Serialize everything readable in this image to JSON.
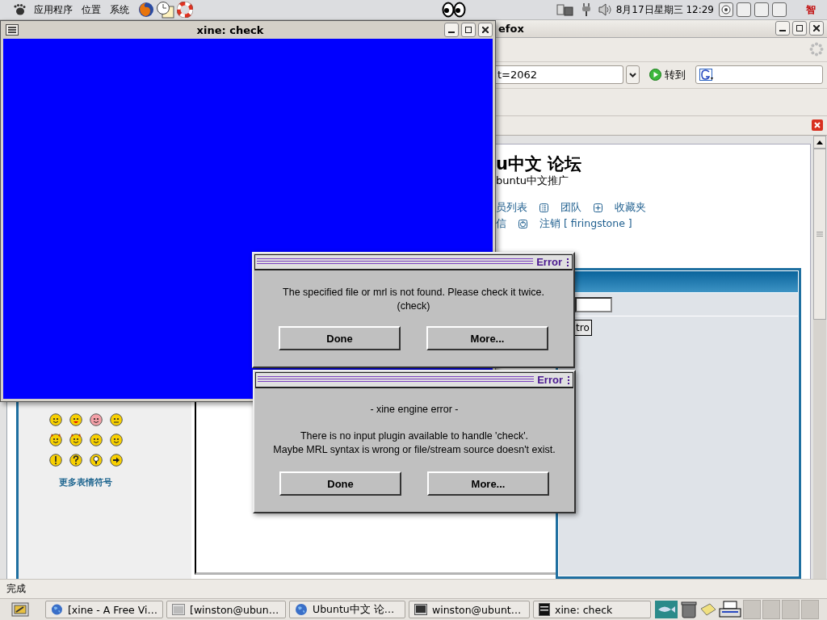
{
  "top_panel": {
    "menus": [
      {
        "label": "应用程序"
      },
      {
        "label": "位置"
      },
      {
        "label": "系统"
      }
    ],
    "clock": "8月17日星期三 12:29",
    "input_method": "智"
  },
  "browser_window": {
    "title": "efox",
    "address": "t=2062",
    "go_label": "转到",
    "page": {
      "heading": "u中文 论坛",
      "subheading": "buntu中文推广",
      "link_rows": [
        [
          {
            "label": "员列表",
            "kind": "plain"
          },
          {
            "label": "团队",
            "kind": "list"
          },
          {
            "label": "收藏夹",
            "kind": "add"
          }
        ],
        [
          {
            "label": "信",
            "kind": "plain"
          },
          {
            "label": "注销 [ firingstone ]",
            "kind": "logout"
          }
        ]
      ],
      "emoticons_link": "更多表情符号",
      "form_button": "tro"
    },
    "status": "完成"
  },
  "xine_window": {
    "title": "xine: check"
  },
  "error_dialogs": [
    {
      "title": "Error",
      "paragraphs": [
        "The specified file or mrl is not found. Please check it twice.\n(check)"
      ],
      "buttons": [
        {
          "label": "Done"
        },
        {
          "label": "More..."
        }
      ]
    },
    {
      "title": "Error",
      "paragraphs": [
        "- xine engine error -",
        "There is no input plugin available to handle 'check'.\nMaybe MRL syntax is wrong or file/stream source doesn't exist."
      ],
      "buttons": [
        {
          "label": "Done"
        },
        {
          "label": "More..."
        }
      ]
    }
  ],
  "taskbar": {
    "items": [
      {
        "label": "[xine - A Free Vi…",
        "kind": "globe"
      },
      {
        "label": "[winston@ubun…",
        "kind": "blank-window"
      },
      {
        "label": "Ubuntu中文 论…",
        "kind": "globe"
      },
      {
        "label": "winston@ubunt…",
        "kind": "terminal"
      },
      {
        "label": "xine: check",
        "kind": "video"
      }
    ]
  }
}
